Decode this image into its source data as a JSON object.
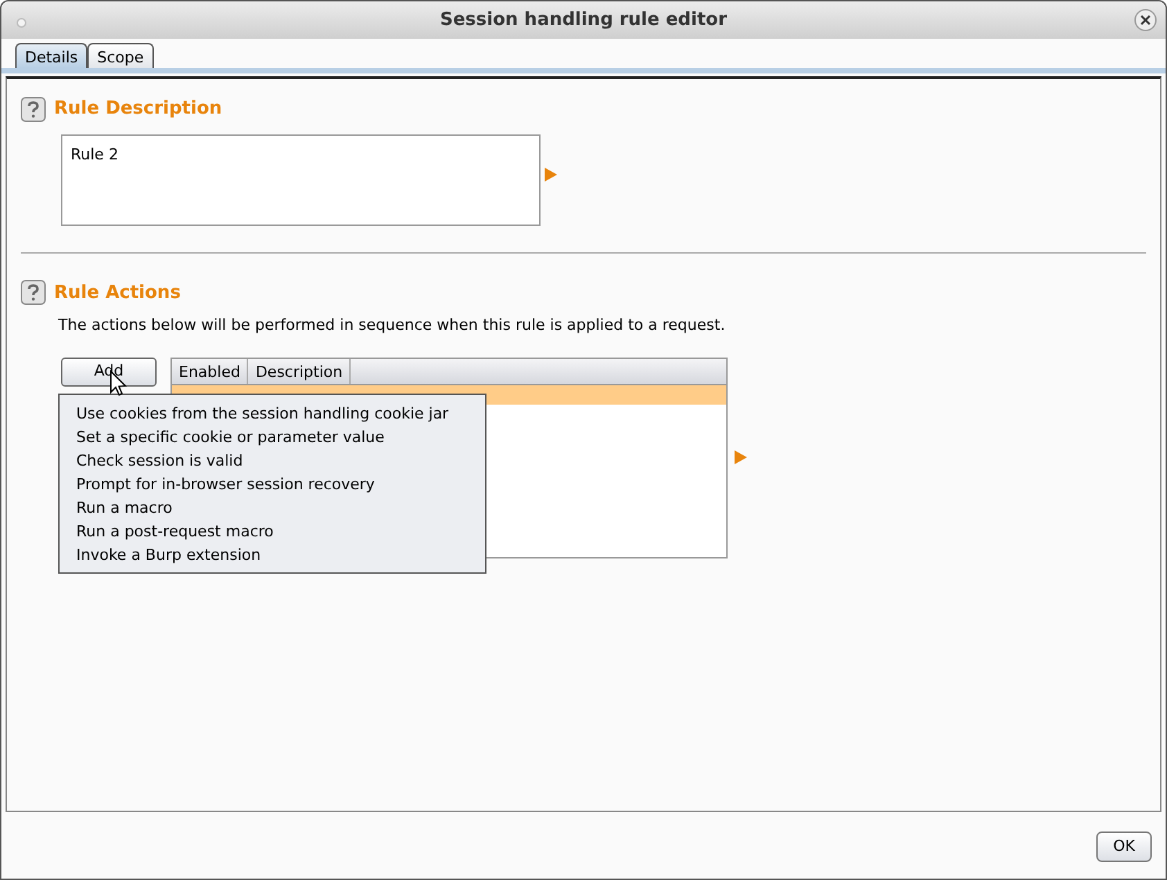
{
  "window": {
    "title": "Session handling rule editor"
  },
  "tabs": [
    {
      "label": "Details",
      "selected": true
    },
    {
      "label": "Scope",
      "selected": false
    }
  ],
  "rule_description": {
    "heading": "Rule Description",
    "value": "Rule 2"
  },
  "rule_actions": {
    "heading": "Rule Actions",
    "intro": "The actions below will be performed in sequence when this rule is applied to a request.",
    "add_button": "Add",
    "table": {
      "columns": [
        "Enabled",
        "Description"
      ],
      "rows": [
        {
          "selected": true
        }
      ]
    },
    "add_menu": [
      "Use cookies from the session handling cookie jar",
      "Set a specific cookie or parameter value",
      "Check session is valid",
      "Prompt for in-browser session recovery",
      "Run a macro",
      "Run a post-request macro",
      "Invoke a Burp extension"
    ]
  },
  "buttons": [
    "OK"
  ]
}
